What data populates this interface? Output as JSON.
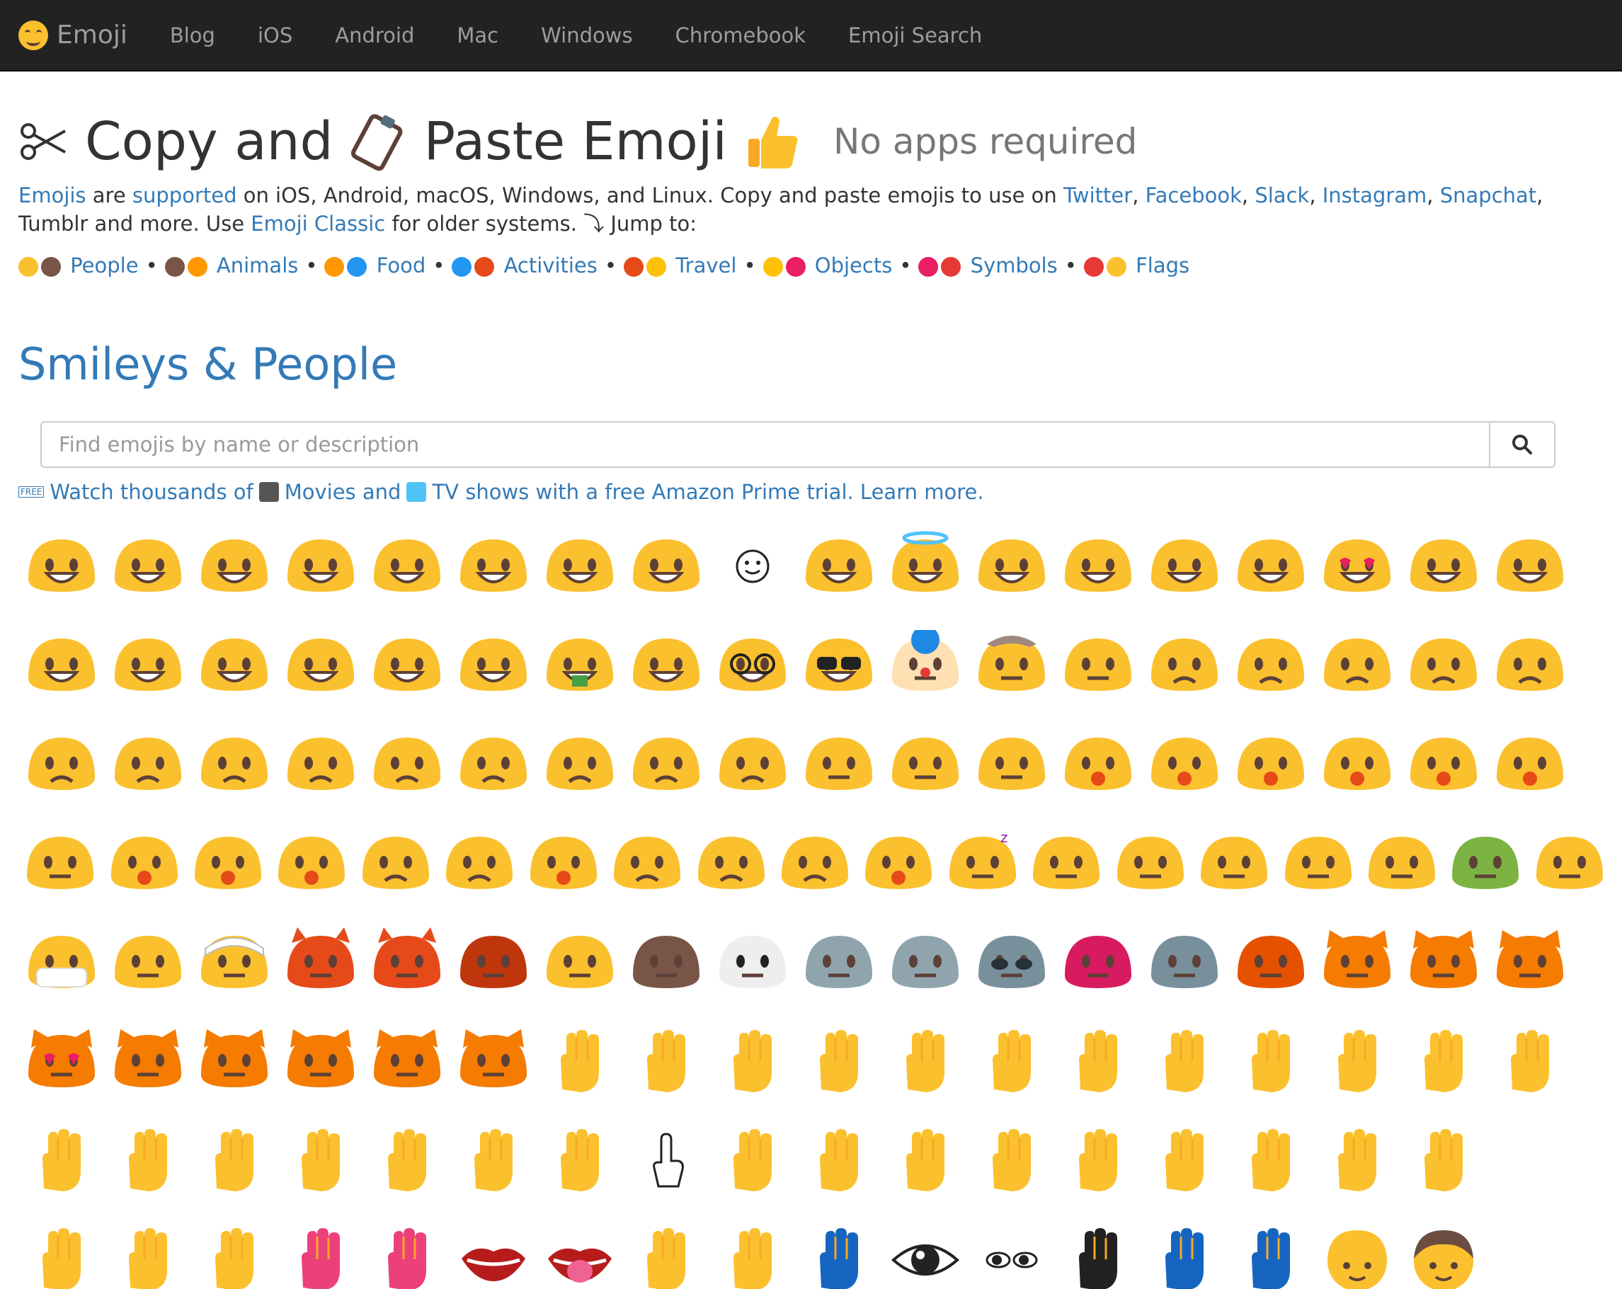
{
  "navbar": {
    "brand": "Emoji",
    "items": [
      "Blog",
      "iOS",
      "Android",
      "Mac",
      "Windows",
      "Chromebook",
      "Emoji Search"
    ]
  },
  "header": {
    "title_part1": "Copy and",
    "title_part2": "Paste Emoji",
    "subtitle": "No apps required"
  },
  "intro": {
    "w1": "Emojis",
    "t1": " are ",
    "w2": "supported",
    "t2": " on iOS, Android, macOS, Windows, and Linux. Copy and paste emojis to use on ",
    "l1": "Twitter",
    "c1": ", ",
    "l2": "Facebook",
    "c2": ", ",
    "l3": "Slack",
    "c3": ", ",
    "l4": "Instagram",
    "c4": ", ",
    "l5": "Snapchat",
    "t3": ", Tumblr and more. Use ",
    "l6": "Emoji Classic",
    "t4": " for older systems. ⤵ Jump to:"
  },
  "jump": {
    "categories": [
      "People",
      "Animals",
      "Food",
      "Activities",
      "Travel",
      "Objects",
      "Symbols",
      "Flags"
    ],
    "separator": "•",
    "icon_colors": [
      "#fbc02d",
      "#795548",
      "#ff9800",
      "#2196f3",
      "#e64a19",
      "#ffc107",
      "#e91e63",
      "#e53935"
    ]
  },
  "section": {
    "title": "Smileys & People"
  },
  "search": {
    "placeholder": "Find emojis by name or description",
    "icon": "search-icon"
  },
  "promo": {
    "tag": "FREE",
    "t1": "Watch thousands of",
    "t2": "Movies and",
    "t3": "TV shows with a free Amazon Prime trial. Learn more."
  },
  "emoji_rows": [
    [
      "grinning",
      "beaming",
      "smile",
      "big-grin",
      "laughing",
      "sweat-smile",
      "joy",
      "rofl",
      "outline-smile",
      "blush",
      "innocent",
      "slight-smile",
      "upside-down",
      "wink",
      "relieved",
      "heart-eyes",
      "kiss-heart",
      "kissing"
    ],
    [
      "kissing-smile",
      "kissing-closed",
      "yum",
      "tongue-wink",
      "tongue-squint",
      "tongue",
      "money-mouth",
      "hugging",
      "nerd",
      "sunglasses",
      "clown",
      "cowboy",
      "smirk",
      "unamused",
      "disappointed",
      "pensive",
      "worried",
      "confused"
    ],
    [
      "slight-frown",
      "frown",
      "persevering",
      "confounded",
      "tired",
      "weary",
      "triumph",
      "angry",
      "pouting",
      "no-mouth",
      "neutral",
      "expressionless",
      "hushed",
      "frowning-open",
      "anguished",
      "open-mouth",
      "astonished",
      "dizzy"
    ],
    [
      "flushed",
      "screaming",
      "fearful",
      "cold-sweat",
      "crying",
      "loud-cry",
      "drooling",
      "sobbing",
      "sweat",
      "sleepy",
      "yawning",
      "sleeping",
      "eye-roll",
      "thinking",
      "lying",
      "grimacing",
      "zipper",
      "nauseated",
      "sneezing"
    ],
    [
      "mask",
      "thermometer",
      "bandage",
      "smiling-devil",
      "angry-devil",
      "ogre",
      "goblin",
      "poop",
      "ghost",
      "skull",
      "crossbones",
      "alien",
      "monster",
      "robot",
      "pumpkin",
      "cat-smile",
      "cat-grin",
      "cat-joy"
    ],
    [
      "cat-heart",
      "cat-smirk",
      "cat-kiss",
      "cat-scream",
      "cat-cry",
      "cat-pout",
      "open-hands",
      "raised-hands",
      "clapping",
      "folded-hands",
      "handshake",
      "thumbs-up",
      "thumbs-down",
      "fist",
      "raised-fist",
      "left-fist",
      "right-fist",
      "crossed-fingers"
    ],
    [
      "victory",
      "horns",
      "ok-hand",
      "point-left",
      "point-right",
      "point-up",
      "point-down",
      "point-up-outline",
      "raised-hand",
      "back-hand",
      "splayed-hand",
      "vulcan",
      "waving",
      "call-me",
      "flexed",
      "middle-finger",
      "writing-hand"
    ],
    [
      "selfie",
      "nail-polish",
      "vulcan-2",
      "lipstick",
      "kiss-mark",
      "lips",
      "tongue-out",
      "ear",
      "nose",
      "footprints",
      "eye",
      "eyes",
      "speaking-head",
      "bust",
      "busts",
      "baby",
      "boy"
    ]
  ],
  "colors": {
    "navbar_bg": "#222222",
    "nav_text": "#9d9d9d",
    "link": "#337ab7",
    "emoji_yellow": "#fbc02d",
    "cat_orange": "#f57c00",
    "devil_red": "#e64a19"
  }
}
